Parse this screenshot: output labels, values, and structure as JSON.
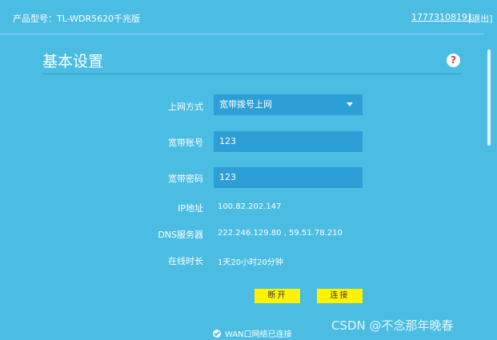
{
  "header": {
    "product_model": "产品型号：TL-WDR5620千兆版",
    "phone": "17773108191",
    "logout": "[退出]"
  },
  "page": {
    "title": "基本设置",
    "help_icon": "?"
  },
  "form": {
    "wan_mode_label": "上网方式",
    "wan_mode_value": "宽带拨号上网",
    "account_label": "宽带账号",
    "account_value": "123",
    "password_label": "宽带密码",
    "password_value": "123",
    "ip_label": "IP地址",
    "ip_value": "100.82.202.147",
    "dns_label": "DNS服务器",
    "dns_value": "222.246.129.80 , 59.51.78.210",
    "uptime_label": "在线时长",
    "uptime_value": "1天20小时20分钟"
  },
  "buttons": {
    "disconnect": "断开",
    "connect": "连接"
  },
  "status": {
    "text": "WAN口网络已连接",
    "icon": "check-circle-icon"
  },
  "watermark": "CSDN @不念那年晚春",
  "colors": {
    "background": "#4bbde2",
    "field": "#2c9fd6",
    "button": "#fff200",
    "help_icon": "#e03b24"
  }
}
